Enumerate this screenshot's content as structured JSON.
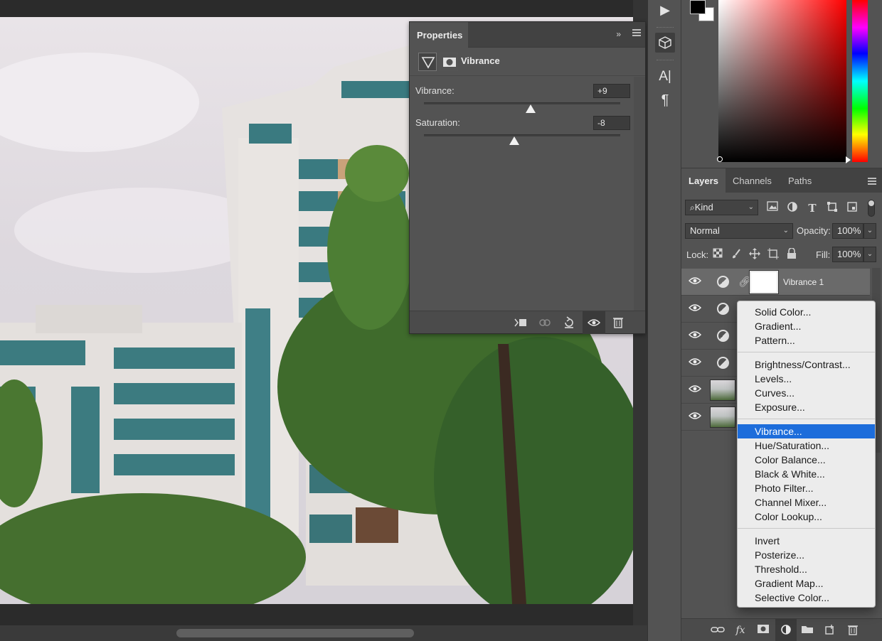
{
  "properties": {
    "tab_label": "Properties",
    "collapse_glyph": "»",
    "adjustment_title": "Vibrance",
    "vibrance": {
      "label": "Vibrance:",
      "value": "+9",
      "position": 0.545
    },
    "saturation": {
      "label": "Saturation:",
      "value": "-8",
      "position": 0.46
    }
  },
  "tools": {
    "play_glyph": "▶",
    "character_glyph": "A|",
    "paragraph_glyph": "¶"
  },
  "colors": {
    "foreground": "#000000",
    "background": "#ffffff",
    "highlight": "#1d6ddb"
  },
  "layers": {
    "tabs": [
      "Layers",
      "Channels",
      "Paths"
    ],
    "filter": {
      "value": "Kind"
    },
    "blend_mode": "Normal",
    "opacity": {
      "label": "Opacity:",
      "value": "100%"
    },
    "lock_label": "Lock:",
    "fill": {
      "label": "Fill:",
      "value": "100%"
    },
    "rows": [
      {
        "name": "Vibrance 1",
        "type": "adjustment",
        "selected": true
      },
      {
        "name": "",
        "type": "adjustment",
        "selected": false
      },
      {
        "name": "",
        "type": "adjustment",
        "selected": false
      },
      {
        "name": "",
        "type": "adjustment",
        "selected": false
      },
      {
        "name": "",
        "type": "image",
        "selected": false
      },
      {
        "name": "",
        "type": "image",
        "selected": false
      }
    ],
    "footer_fx": "fx"
  },
  "menu": {
    "groups": [
      [
        "Solid Color...",
        "Gradient...",
        "Pattern..."
      ],
      [
        "Brightness/Contrast...",
        "Levels...",
        "Curves...",
        "Exposure..."
      ],
      [
        "Vibrance...",
        "Hue/Saturation...",
        "Color Balance...",
        "Black & White...",
        "Photo Filter...",
        "Channel Mixer...",
        "Color Lookup..."
      ],
      [
        "Invert",
        "Posterize...",
        "Threshold...",
        "Gradient Map...",
        "Selective Color..."
      ]
    ],
    "highlighted": "Vibrance..."
  }
}
